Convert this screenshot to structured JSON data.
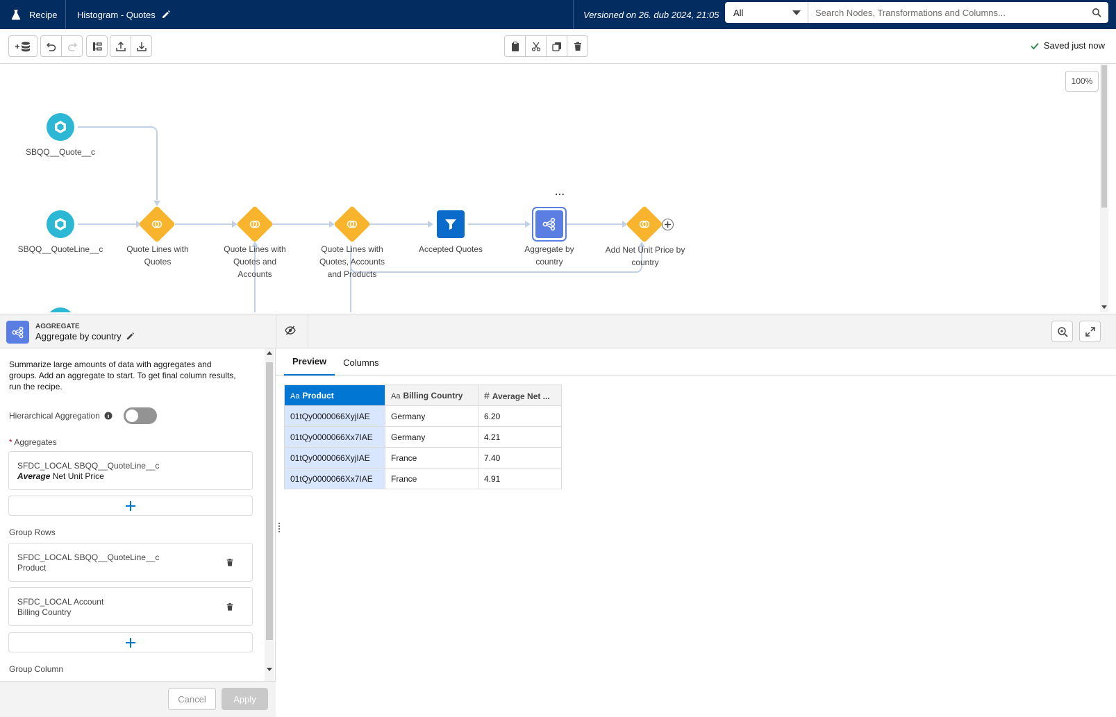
{
  "topbar": {
    "app_label": "Recipe",
    "recipe_title": "Histogram - Quotes",
    "version_text": "Versioned on 26. dub 2024, 21:05",
    "search_scope": "All",
    "search_placeholder": "Search Nodes, Transformations and Columns..."
  },
  "toolbar": {
    "saved_text": "Saved just now"
  },
  "canvas": {
    "zoom_level": "100%",
    "more_label": "...",
    "nodes": {
      "quote": "SBQQ__Quote__c",
      "quoteline": "SBQQ__QuoteLine__c",
      "join1": "Quote Lines with Quotes",
      "join2": "Quote Lines with Quotes and Accounts",
      "join3": "Quote Lines with Quotes, Accounts and Products",
      "filter": "Accepted Quotes",
      "aggregate": "Aggregate by country",
      "join4": "Add Net Unit Price by country"
    }
  },
  "panel": {
    "node_type": "AGGREGATE",
    "node_name": "Aggregate by country",
    "description": "Summarize large amounts of data with aggregates and groups. Add an aggregate to start. To get final column results, run the recipe.",
    "hierarchical_label": "Hierarchical Aggregation",
    "aggregates_label": "Aggregates",
    "aggregate_item": {
      "source": "SFDC_LOCAL SBQQ__QuoteLine__c",
      "function": "Average",
      "field": "Net Unit Price"
    },
    "group_rows_label": "Group Rows",
    "group_rows": [
      {
        "source": "SFDC_LOCAL SBQQ__QuoteLine__c",
        "field": "Product"
      },
      {
        "source": "SFDC_LOCAL Account",
        "field": "Billing Country"
      }
    ],
    "group_column_label": "Group Column",
    "cancel_label": "Cancel",
    "apply_label": "Apply"
  },
  "preview": {
    "tabs": [
      "Preview",
      "Columns"
    ],
    "columns": [
      {
        "type": "Aa",
        "name": "Product"
      },
      {
        "type": "Aa",
        "name": "Billing Country"
      },
      {
        "type": "#",
        "name": "Average Net ..."
      }
    ],
    "rows": [
      [
        "01tQy0000066XyjIAE",
        "Germany",
        "6.20"
      ],
      [
        "01tQy0000066Xx7IAE",
        "Germany",
        "4.21"
      ],
      [
        "01tQy0000066XyjIAE",
        "France",
        "7.40"
      ],
      [
        "01tQy0000066Xx7IAE",
        "France",
        "4.91"
      ]
    ]
  },
  "colors": {
    "header_bg": "#032d60",
    "brand_blue": "#0176d3",
    "input_node": "#2cb8d4",
    "join_node": "#f8b42c",
    "filter_node": "#0b6bcb",
    "aggregate_node": "#5a7ee2"
  }
}
